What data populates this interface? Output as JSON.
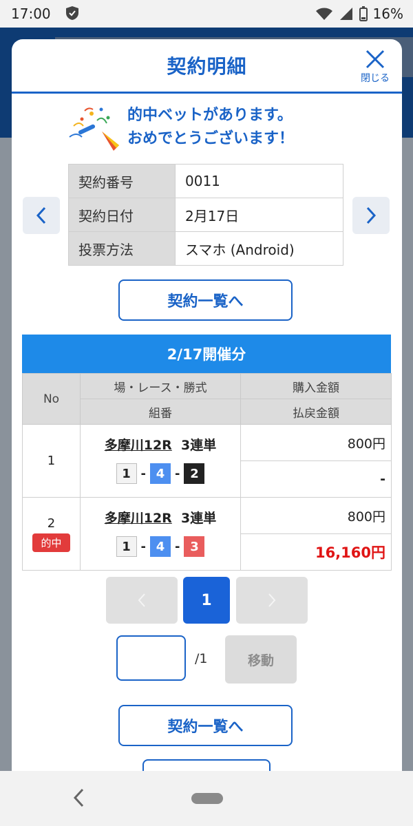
{
  "status_bar": {
    "time": "17:00",
    "battery": "16%"
  },
  "dialog": {
    "title": "契約明細",
    "close_label": "閉じる",
    "win_message_line1": "的中ベットがあります。",
    "win_message_line2": "おめでとうございます！",
    "info": [
      {
        "key": "契約番号",
        "value": "0011"
      },
      {
        "key": "契約日付",
        "value": "2月17日"
      },
      {
        "key": "投票方法",
        "value": "スマホ (Android)"
      }
    ],
    "list_button": "契約一覧へ",
    "section_title": "2/17開催分",
    "table_headers": {
      "no": "No",
      "race": "場・レース・勝式",
      "combination": "組番",
      "purchase": "購入金額",
      "payout": "払戻金額"
    },
    "bets": [
      {
        "no": "1",
        "venue": "多摩川12R",
        "type": "3連単",
        "combo": [
          "1",
          "4",
          "2"
        ],
        "purchase": "800円",
        "payout": "-",
        "hit": ""
      },
      {
        "no": "2",
        "venue": "多摩川12R",
        "type": "3連単",
        "combo": [
          "1",
          "4",
          "3"
        ],
        "purchase": "800円",
        "payout": "16,160円",
        "hit": "的中"
      }
    ],
    "pager": {
      "current_page": "1",
      "total": "/1",
      "move_label": "移動",
      "input_value": ""
    },
    "list_button_bottom": "契約一覧へ"
  },
  "colors": {
    "accent": "#1a63c7",
    "section_header": "#1e8ae8",
    "hit_red": "#e01515"
  }
}
